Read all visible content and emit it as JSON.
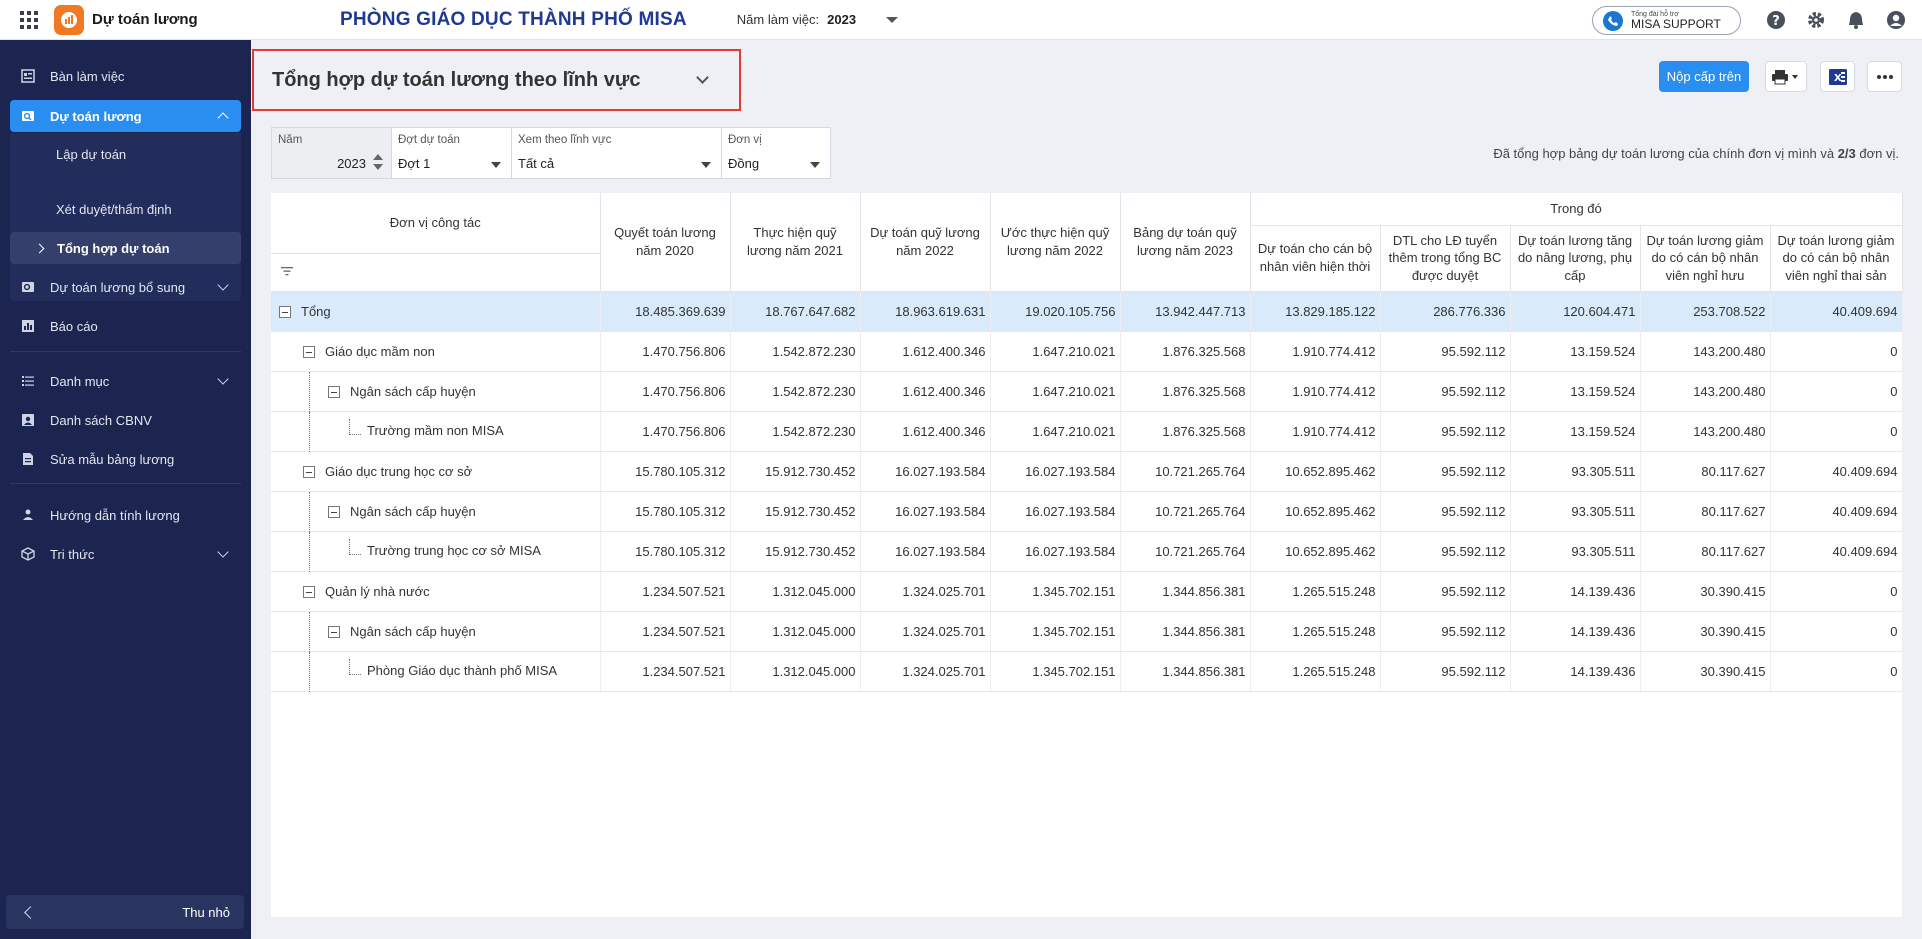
{
  "app": {
    "name": "Dự toán lương",
    "org_name": "PHÒNG GIÁO DỤC THÀNH PHỐ MISA",
    "year_label": "Năm làm việc:",
    "year_value": "2023"
  },
  "support": {
    "small": "Tổng đài hỗ trợ",
    "big": "MISA SUPPORT"
  },
  "colors": {
    "accent": "#2a8ef0",
    "sidebar": "#1c2550",
    "highlight_row": "#d9ebfb",
    "org_name": "#1f3a93"
  },
  "sidebar": {
    "items": [
      {
        "label": "Bàn làm việc",
        "icon": "dashboard-icon"
      },
      {
        "label": "Dự toán lương",
        "icon": "search-doc-icon"
      },
      {
        "label": "Dự toán lương bổ sung",
        "icon": "doc-plus-icon"
      },
      {
        "label": "Báo cáo",
        "icon": "chart-icon"
      },
      {
        "label": "Danh mục",
        "icon": "list-icon"
      },
      {
        "label": "Danh sách CBNV",
        "icon": "person-icon"
      },
      {
        "label": "Sửa mẫu bảng lương",
        "icon": "doc-edit-icon"
      },
      {
        "label": "Hướng dẫn tính lương",
        "icon": "guide-icon"
      },
      {
        "label": "Tri thức",
        "icon": "cube-icon"
      }
    ],
    "sub_items": [
      "Lập dự toán",
      "Xét duyệt/thẩm định",
      "Tổng hợp dự toán"
    ],
    "collapse_label": "Thu nhỏ"
  },
  "page": {
    "title": "Tổng hợp dự toán lương theo lĩnh vực",
    "submit_label": "Nộp cấp trên",
    "summary_prefix": "Đã tổng hợp bảng dự toán lương của chính đơn vị mình và",
    "summary_count": "2/3",
    "summary_suffix": "đơn vị."
  },
  "filters": {
    "year": {
      "label": "Năm",
      "value": "2023"
    },
    "period": {
      "label": "Đợt dự toán",
      "value": "Đợt 1"
    },
    "field": {
      "label": "Xem theo lĩnh vực",
      "value": "Tất cả"
    },
    "unit": {
      "label": "Đơn vị",
      "value": "Đồng"
    }
  },
  "table": {
    "headers": {
      "unit": "Đơn vị công tác",
      "c1": "Quyết toán lương năm 2020",
      "c2": "Thực hiện quỹ lương năm 2021",
      "c3": "Dự toán quỹ lương năm 2022",
      "c4": "Ước thực hiện quỹ lương năm 2022",
      "c5": "Bảng dự toán quỹ lương năm 2023",
      "group": "Trong đó",
      "g1": "Dự toán cho cán bộ nhân viên hiện thời",
      "g2": "DTL cho LĐ tuyển thêm trong tổng BC được duyệt",
      "g3": "Dự toán lương tăng do nâng lương, phụ cấp",
      "g4": "Dự toán lương giảm do có cán bộ nhân viên nghỉ hưu",
      "g5": "Dự toán lương giảm do có cán bộ nhân viên nghỉ thai sản"
    },
    "rows": [
      {
        "name": "Tổng",
        "level": 0,
        "v": [
          "18.485.369.639",
          "18.767.647.682",
          "18.963.619.631",
          "19.020.105.756",
          "13.942.447.713",
          "13.829.185.122",
          "286.776.336",
          "120.604.471",
          "253.708.522",
          "40.409.694"
        ]
      },
      {
        "name": "Giáo dục mầm non",
        "level": 1,
        "v": [
          "1.470.756.806",
          "1.542.872.230",
          "1.612.400.346",
          "1.647.210.021",
          "1.876.325.568",
          "1.910.774.412",
          "95.592.112",
          "13.159.524",
          "143.200.480",
          "0"
        ]
      },
      {
        "name": "Ngân sách cấp huyện",
        "level": 2,
        "v": [
          "1.470.756.806",
          "1.542.872.230",
          "1.612.400.346",
          "1.647.210.021",
          "1.876.325.568",
          "1.910.774.412",
          "95.592.112",
          "13.159.524",
          "143.200.480",
          "0"
        ]
      },
      {
        "name": "Trường mầm non MISA",
        "level": 3,
        "v": [
          "1.470.756.806",
          "1.542.872.230",
          "1.612.400.346",
          "1.647.210.021",
          "1.876.325.568",
          "1.910.774.412",
          "95.592.112",
          "13.159.524",
          "143.200.480",
          "0"
        ]
      },
      {
        "name": "Giáo dục trung học cơ sở",
        "level": 1,
        "v": [
          "15.780.105.312",
          "15.912.730.452",
          "16.027.193.584",
          "16.027.193.584",
          "10.721.265.764",
          "10.652.895.462",
          "95.592.112",
          "93.305.511",
          "80.117.627",
          "40.409.694"
        ]
      },
      {
        "name": "Ngân sách cấp huyện",
        "level": 2,
        "v": [
          "15.780.105.312",
          "15.912.730.452",
          "16.027.193.584",
          "16.027.193.584",
          "10.721.265.764",
          "10.652.895.462",
          "95.592.112",
          "93.305.511",
          "80.117.627",
          "40.409.694"
        ]
      },
      {
        "name": "Trường trung học cơ sở MISA",
        "level": 3,
        "v": [
          "15.780.105.312",
          "15.912.730.452",
          "16.027.193.584",
          "16.027.193.584",
          "10.721.265.764",
          "10.652.895.462",
          "95.592.112",
          "93.305.511",
          "80.117.627",
          "40.409.694"
        ]
      },
      {
        "name": "Quản lý nhà nước",
        "level": 1,
        "v": [
          "1.234.507.521",
          "1.312.045.000",
          "1.324.025.701",
          "1.345.702.151",
          "1.344.856.381",
          "1.265.515.248",
          "95.592.112",
          "14.139.436",
          "30.390.415",
          "0"
        ]
      },
      {
        "name": "Ngân sách cấp huyện",
        "level": 2,
        "v": [
          "1.234.507.521",
          "1.312.045.000",
          "1.324.025.701",
          "1.345.702.151",
          "1.344.856.381",
          "1.265.515.248",
          "95.592.112",
          "14.139.436",
          "30.390.415",
          "0"
        ]
      },
      {
        "name": "Phòng Giáo dục thành phố MISA",
        "level": 3,
        "v": [
          "1.234.507.521",
          "1.312.045.000",
          "1.324.025.701",
          "1.345.702.151",
          "1.344.856.381",
          "1.265.515.248",
          "95.592.112",
          "14.139.436",
          "30.390.415",
          "0"
        ]
      }
    ]
  }
}
